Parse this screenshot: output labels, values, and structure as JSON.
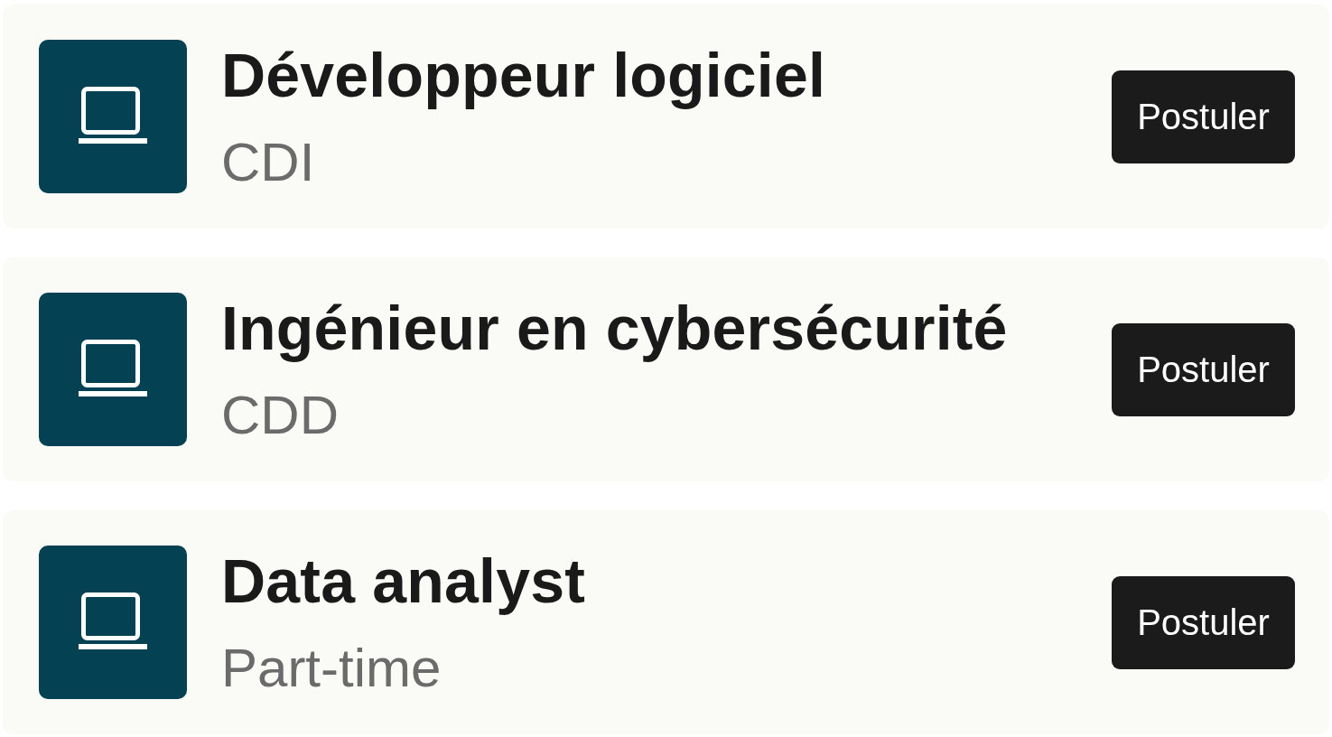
{
  "jobs": [
    {
      "title": "Développeur logiciel",
      "contract": "CDI",
      "action": "Postuler"
    },
    {
      "title": "Ingénieur en cybersécurité",
      "contract": "CDD",
      "action": "Postuler"
    },
    {
      "title": "Data analyst",
      "contract": "Part-time",
      "action": "Postuler"
    }
  ]
}
